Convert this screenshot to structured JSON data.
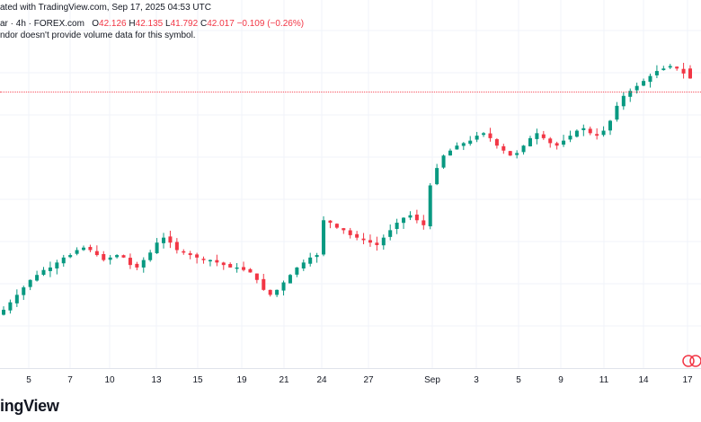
{
  "header": {
    "published": "ated with TradingView.com, Sep 17, 2025 04:53 UTC",
    "symbol": "ar · 4h · FOREX.com",
    "ohlc": {
      "o_label": "O",
      "o": "42.126",
      "h_label": "H",
      "h": "42.135",
      "l_label": "L",
      "l": "41.792",
      "c_label": "C",
      "c": "42.017",
      "change": "−0.109 (−0.26%)"
    },
    "volume_note": "ndor doesn't provide volume data for this symbol."
  },
  "branding": {
    "name": "ingView",
    "logo_icon": "tradingview-logo-icon"
  },
  "colors": {
    "up": "#089981",
    "down": "#f23645",
    "grid": "#f0f3fa",
    "axis": "#e0e3eb"
  },
  "chart_data": {
    "type": "candlestick",
    "x_tick_labels": [
      "5",
      "7",
      "10",
      "13",
      "15",
      "19",
      "21",
      "24",
      "27",
      "Sep",
      "3",
      "5",
      "9",
      "11",
      "14",
      "17"
    ],
    "last_price_line": true,
    "series_description": "4h candles trending upward from left to right, with peak near the right edge",
    "trend_points_normalized_price": [
      0.0,
      0.03,
      0.06,
      0.09,
      0.12,
      0.14,
      0.16,
      0.17,
      0.19,
      0.21,
      0.22,
      0.24,
      0.25,
      0.24,
      0.22,
      0.2,
      0.21,
      0.22,
      0.21,
      0.18,
      0.17,
      0.2,
      0.23,
      0.27,
      0.29,
      0.27,
      0.24,
      0.23,
      0.22,
      0.21,
      0.2,
      0.2,
      0.19,
      0.18,
      0.17,
      0.17,
      0.16,
      0.15,
      0.12,
      0.08,
      0.06,
      0.08,
      0.11,
      0.14,
      0.17,
      0.19,
      0.21,
      0.22,
      0.36,
      0.35,
      0.33,
      0.32,
      0.3,
      0.29,
      0.28,
      0.27,
      0.26,
      0.29,
      0.32,
      0.35,
      0.37,
      0.38,
      0.36,
      0.34,
      0.5,
      0.57,
      0.62,
      0.64,
      0.66,
      0.67,
      0.68,
      0.7,
      0.71,
      0.69,
      0.66,
      0.64,
      0.62,
      0.63,
      0.66,
      0.69,
      0.71,
      0.69,
      0.67,
      0.66,
      0.68,
      0.7,
      0.72,
      0.73,
      0.71,
      0.7,
      0.72,
      0.76,
      0.82,
      0.86,
      0.88,
      0.9,
      0.92,
      0.94,
      0.96,
      0.97,
      0.98,
      0.97,
      0.95,
      0.93
    ]
  }
}
